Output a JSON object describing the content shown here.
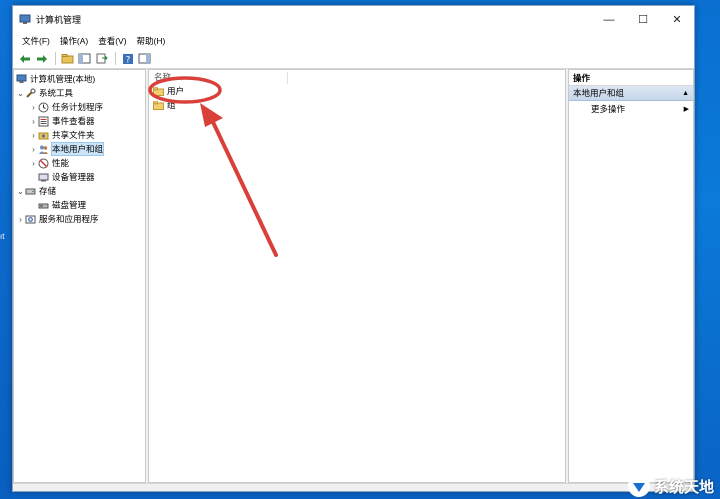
{
  "window": {
    "title": "计算机管理",
    "minimize": "—",
    "maximize": "☐",
    "close": "✕"
  },
  "menu": [
    "文件(F)",
    "操作(A)",
    "查看(V)",
    "帮助(H)"
  ],
  "desktop": {
    "fragment": "ıt"
  },
  "tree": {
    "root": "计算机管理(本地)",
    "items": [
      {
        "label": "系统工具",
        "indent": 0,
        "expander": "⌄",
        "icon": "tools-icon"
      },
      {
        "label": "任务计划程序",
        "indent": 1,
        "expander": "›",
        "icon": "clock-icon"
      },
      {
        "label": "事件查看器",
        "indent": 1,
        "expander": "›",
        "icon": "event-viewer-icon"
      },
      {
        "label": "共享文件夹",
        "indent": 1,
        "expander": "›",
        "icon": "shared-folder-icon"
      },
      {
        "label": "本地用户和组",
        "indent": 1,
        "expander": "›",
        "icon": "users-icon",
        "selected": true
      },
      {
        "label": "性能",
        "indent": 1,
        "expander": "›",
        "icon": "performance-icon"
      },
      {
        "label": "设备管理器",
        "indent": 1,
        "expander": "",
        "icon": "device-manager-icon"
      },
      {
        "label": "存储",
        "indent": 0,
        "expander": "⌄",
        "icon": "storage-icon"
      },
      {
        "label": "磁盘管理",
        "indent": 1,
        "expander": "",
        "icon": "disk-icon"
      },
      {
        "label": "服务和应用程序",
        "indent": 0,
        "expander": "›",
        "icon": "services-icon"
      }
    ]
  },
  "list": {
    "column_header": "名称",
    "rows": [
      "用户",
      "组"
    ]
  },
  "actions": {
    "header": "操作",
    "group": "本地用户和组",
    "group_arrow": "▲",
    "items": [
      {
        "label": "更多操作",
        "arrow": "▶"
      }
    ]
  },
  "watermark": "系统天地",
  "colors": {
    "annotation": "#d9403a",
    "selection": "#cce4f7",
    "desktop": "#0a6fd0"
  }
}
